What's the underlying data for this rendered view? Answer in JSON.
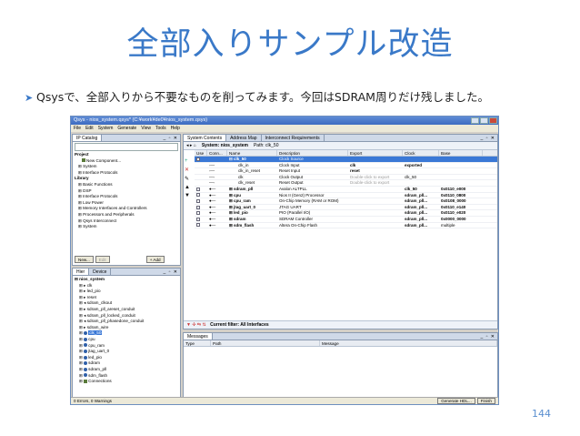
{
  "slide": {
    "title": "全部入りサンプル改造",
    "bullet": "Qsysで、全部入りから不要なものを削ってみます。今回はSDRAM周りだけ残しました。",
    "page_number": "144"
  },
  "window": {
    "title": "Qsys - nios_system.qsys* (C:¥work¥de0¥nios_system.qsys)",
    "menu": [
      "File",
      "Edit",
      "System",
      "Generate",
      "View",
      "Tools",
      "Help"
    ]
  },
  "library_panel": {
    "tab": "IP Catalog",
    "items": [
      "Project",
      "New Component...",
      "System",
      "Interface Protocols",
      "Library",
      "Basic Functions",
      "DSP",
      "Interface Protocols",
      "Low Power",
      "Memory Interfaces and Controllers",
      "Processors and Peripherals",
      "Qsys Interconnect",
      "System"
    ],
    "new_button": "New...",
    "edit_button": "Edit",
    "add_button": "+ Add"
  },
  "hierarchy_panel": {
    "tabs": [
      "Hier",
      "Device"
    ],
    "items": [
      "nios_system",
      "clk",
      "led_pio",
      "reset",
      "sdram_clkout",
      "sdram_pll_areset_conduit",
      "sdram_pll_locked_conduit",
      "sdram_pll_phasedone_conduit",
      "sdram_wire",
      "clk_50",
      "cpu",
      "cpu_ram",
      "jtag_uart_0",
      "led_pio",
      "sdram",
      "sdram_pll",
      "sdm_flash",
      "Connections"
    ],
    "selected": "clk_50"
  },
  "main_panel": {
    "tabs": [
      "System Contents",
      "Address Map",
      "Interconnect Requirements"
    ],
    "system_label": "System: nios_system",
    "path_label": "Path: clk_50",
    "columns": [
      "Use",
      "Conn...",
      "Name",
      "Description",
      "Export",
      "Clock",
      "Base"
    ],
    "rows": [
      {
        "name": "clk_50",
        "desc": "Clock Source",
        "export": "",
        "clock": "",
        "base": "",
        "selected": true
      },
      {
        "name": "clk_in",
        "desc": "Clock Input",
        "export": "clk",
        "clock": "exported",
        "base": ""
      },
      {
        "name": "clk_in_reset",
        "desc": "Reset Input",
        "export": "reset",
        "clock": "",
        "base": ""
      },
      {
        "name": "clk",
        "desc": "Clock Output",
        "export": "Double-click to export",
        "clock": "clk_50",
        "base": ""
      },
      {
        "name": "clk_reset",
        "desc": "Reset Output",
        "export": "Double-click to export",
        "clock": "",
        "base": ""
      },
      {
        "name": "sdram_pll",
        "desc": "Avalon ALTPLL",
        "export": "",
        "clock": "clk_50",
        "base": "0x0110_e000"
      },
      {
        "name": "cpu",
        "desc": "Nios II (Gen2) Processor",
        "export": "",
        "clock": "sdram_pll...",
        "base": "0x0110_0800"
      },
      {
        "name": "cpu_ram",
        "desc": "On-Chip Memory (RAM or ROM)",
        "export": "",
        "clock": "sdram_pll...",
        "base": "0x0108_0000"
      },
      {
        "name": "jtag_uart_0",
        "desc": "JTAG UART",
        "export": "",
        "clock": "sdram_pll...",
        "base": "0x0110_e140"
      },
      {
        "name": "led_pio",
        "desc": "PIO (Parallel I/O)",
        "export": "",
        "clock": "sdram_pll...",
        "base": "0x0110_e020"
      },
      {
        "name": "sdram",
        "desc": "SDRAM Controller",
        "export": "",
        "clock": "sdram_pll...",
        "base": "0x0000_0000"
      },
      {
        "name": "sdm_flash",
        "desc": "Altera On-Chip Flash",
        "export": "",
        "clock": "sdram_pll...",
        "base": "multiple"
      }
    ],
    "filter_label": "Current filter: All Interfaces"
  },
  "messages_panel": {
    "tab": "Messages",
    "columns": [
      "Type",
      "Path",
      "Message"
    ]
  },
  "status": {
    "text": "0 Errors, 0 Warnings",
    "generate_button": "Generate HDL...",
    "finish_button": "Finish"
  }
}
